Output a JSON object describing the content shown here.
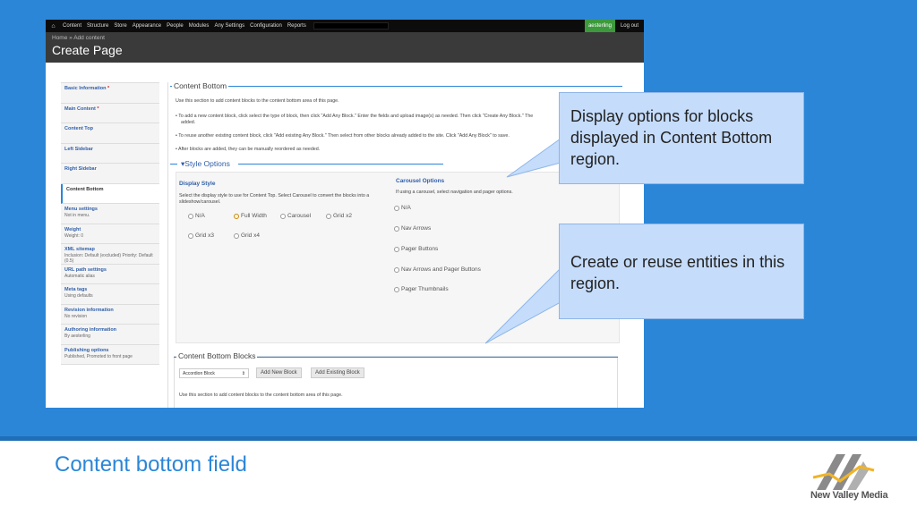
{
  "caption": "Content bottom field",
  "logo": {
    "name": "New Valley Media",
    "colors": {
      "primary": "#8a8a8a",
      "accent": "#f0b429"
    }
  },
  "colors": {
    "slide_blue": "#2b86d8",
    "callout_bg": "#c5dcfb",
    "link": "#2f5fa8"
  },
  "toolbar": {
    "home_icon": "home-icon",
    "menu": [
      "Content",
      "Structure",
      "Store",
      "Appearance",
      "People",
      "Modules",
      "Any Settings",
      "Configuration",
      "Reports"
    ],
    "user": "aesterling",
    "logout": "Log out"
  },
  "header": {
    "breadcrumb": "Home » Add content",
    "title": "Create Page"
  },
  "vtabs": [
    {
      "title": "Basic Information",
      "req": "*",
      "summary": ""
    },
    {
      "title": "Main Content",
      "req": "*",
      "summary": ""
    },
    {
      "title": "Content Top",
      "req": "",
      "summary": ""
    },
    {
      "title": "Left Sidebar",
      "req": "",
      "summary": ""
    },
    {
      "title": "Right Sidebar",
      "req": "",
      "summary": ""
    },
    {
      "title": "Content Bottom",
      "req": "",
      "summary": ""
    },
    {
      "title": "Menu settings",
      "req": "",
      "summary": "Not in menu."
    },
    {
      "title": "Weight",
      "req": "",
      "summary": "Weight: 0"
    },
    {
      "title": "XML sitemap",
      "req": "",
      "summary": "Inclusion: Default (excluded) Priority: Default (0.5)"
    },
    {
      "title": "URL path settings",
      "req": "",
      "summary": "Automatic alias"
    },
    {
      "title": "Meta tags",
      "req": "",
      "summary": "Using defaults"
    },
    {
      "title": "Revision information",
      "req": "",
      "summary": "No revision"
    },
    {
      "title": "Authoring information",
      "req": "",
      "summary": "By aesterling"
    },
    {
      "title": "Publishing options",
      "req": "",
      "summary": "Published, Promoted to front page"
    }
  ],
  "content_bottom": {
    "legend": "Content Bottom",
    "intro": "Use this section to add content blocks to the content bottom area of this page.",
    "bullets": [
      "To add a new content block, click select the type of block, then click \"Add Any Block.\" Enter the fields and upload image(s) as needed. Then click \"Create Any Block.\" The",
      "added.",
      "To reuse another existing content block, click \"Add existing Any Block.\" Then select from other blocks already added to the site. Click \"Add Any Block\" to save.",
      "After blocks are added, they can be manually reordered as needed."
    ]
  },
  "style_options": {
    "legend": "Style Options",
    "toggle": "▾",
    "display_style": {
      "title": "Display Style",
      "help": "Select the display style to use for Content Top. Select Carousel to convert the blocks into a slideshow/carousel.",
      "options": [
        "N/A",
        "Full Width",
        "Carousel",
        "Grid x2",
        "Grid x3",
        "Grid x4"
      ],
      "selected": "Full Width"
    },
    "carousel": {
      "title": "Carousel Options",
      "help": "If using a carousel, select navigation and pager options.",
      "options": [
        "N/A",
        "Nav Arrows",
        "Pager Buttons",
        "Nav Arrows and Pager Buttons",
        "Pager Thumbnails"
      ]
    }
  },
  "blocks": {
    "legend": "Content Bottom Blocks",
    "select_value": "Accordion Block",
    "add_new": "Add New Block",
    "add_existing": "Add Existing Block",
    "help": "Use this section to add content blocks to the content bottom area of this page."
  },
  "callouts": [
    "Display options for blocks displayed in Content Bottom region.",
    "Create or reuse entities in this region."
  ]
}
